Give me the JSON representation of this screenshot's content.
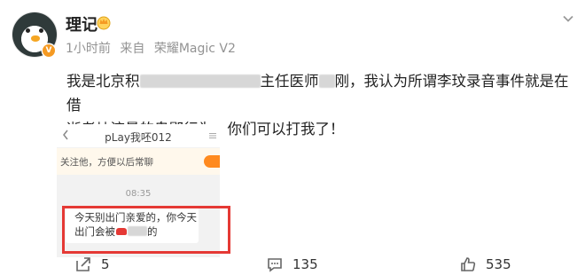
{
  "post": {
    "author": "理记",
    "time": "1小时前",
    "source_prefix": "来自",
    "device": "荣耀Magic V2",
    "text_line1_a": "我是北京积",
    "text_line1_b": "主任医师",
    "text_line1_c": "刚，我认为所谓李玟录音事件就是在借",
    "text_line2": "逝者炒流量的卑鄙行为，你们可以打我了！"
  },
  "screenshot": {
    "title": "pLay我呸012",
    "notice": "关注他，方便以后常聊",
    "time": "08:35",
    "message_line1": "今天别出门亲爱的，你今天",
    "message_line2_a": "出门会被",
    "message_line2_b": "的"
  },
  "actions": {
    "repost_count": "5",
    "comment_count": "135",
    "like_count": "535"
  },
  "colors": {
    "highlight_box": "#e53935",
    "verified_badge": "#f59a23",
    "meta_text": "#939393"
  }
}
